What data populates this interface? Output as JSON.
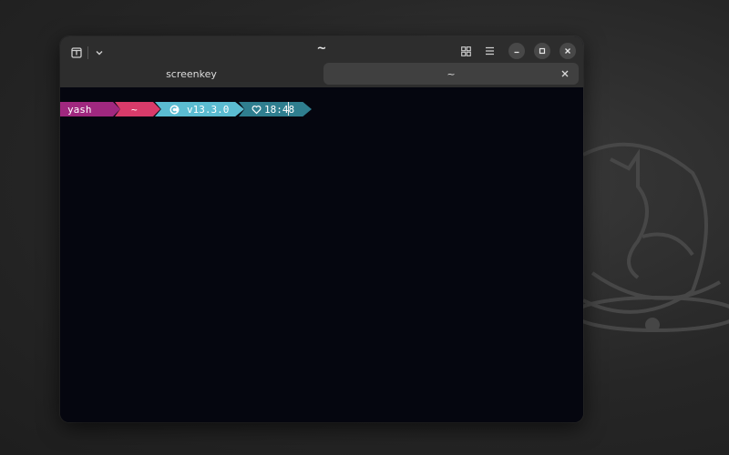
{
  "window": {
    "title": "~",
    "tabs": [
      {
        "label": "screenkey",
        "active": false
      },
      {
        "label": "~",
        "active": true
      }
    ]
  },
  "icons": {
    "new_tab": "new-tab-icon",
    "dropdown": "chevron-down-icon",
    "overview": "grid-icon",
    "menu": "hamburger-menu-icon",
    "minimize": "minimize-icon",
    "maximize": "maximize-icon",
    "close": "close-icon"
  },
  "prompt": {
    "user": "yash",
    "dir": "~",
    "node_version": "v13.3.0",
    "time": "18:48"
  },
  "colors": {
    "user_segment": "#a0287f",
    "dir_segment": "#d83b6a",
    "node_segment": "#5bbcd1",
    "time_segment": "#2f7e8f",
    "terminal_bg": "#05060f",
    "titlebar_bg": "#2d2d2d"
  }
}
